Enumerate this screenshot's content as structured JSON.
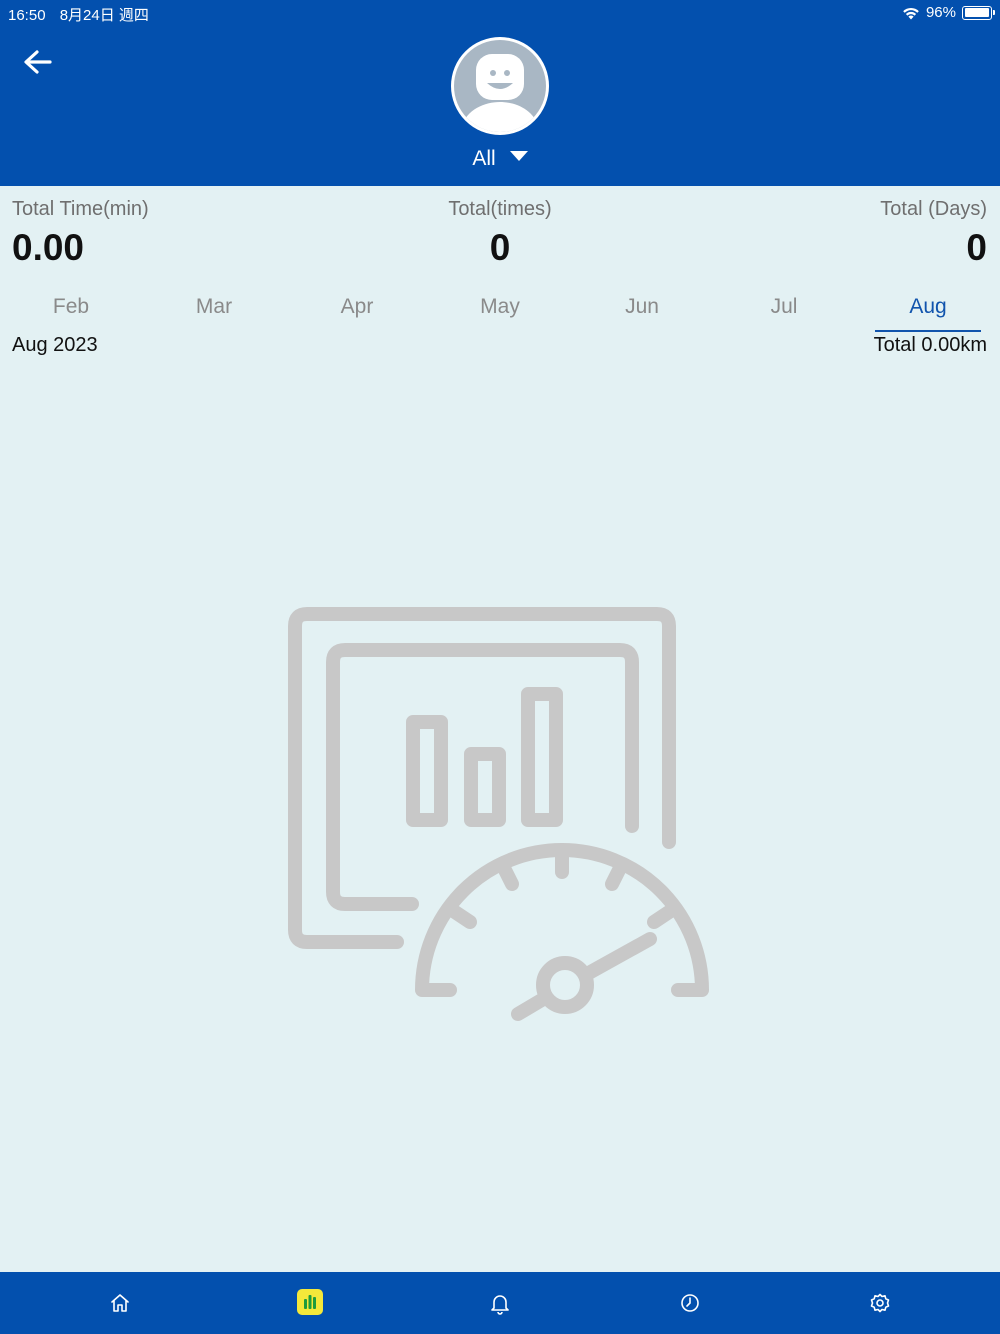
{
  "status_bar": {
    "time": "16:50",
    "date": "8月24日 週四",
    "battery_percent": "96%",
    "battery_level": 0.96,
    "wifi_icon": "wifi-icon"
  },
  "header": {
    "back_icon": "arrow-left-icon",
    "avatar_icon": "user-avatar-icon",
    "user_selector": {
      "label": "All",
      "caret_icon": "caret-down-icon"
    }
  },
  "stats": [
    {
      "label": "Total Time(min)",
      "value": "0.00"
    },
    {
      "label": "Total(times)",
      "value": "0"
    },
    {
      "label": "Total (Days)",
      "value": "0"
    }
  ],
  "months": {
    "items": [
      "Feb",
      "Mar",
      "Apr",
      "May",
      "Jun",
      "Jul",
      "Aug"
    ],
    "selected": "Aug"
  },
  "period": {
    "label": "Aug 2023",
    "total": "Total 0.00km"
  },
  "empty_state": {
    "icon": "dashboard-chart-speedometer-icon"
  },
  "bottom_nav": {
    "items": [
      {
        "icon": "home-icon",
        "active": false
      },
      {
        "icon": "bar-chart-icon",
        "active": true
      },
      {
        "icon": "bell-icon",
        "active": false
      },
      {
        "icon": "clock-icon",
        "active": false
      },
      {
        "icon": "gear-icon",
        "active": false
      }
    ]
  },
  "colors": {
    "primary": "#0350ae",
    "background": "#e3f1f3",
    "active_tab": "#1154ad",
    "nav_active": "#f4e83a",
    "illustration": "#c8c8c8"
  }
}
